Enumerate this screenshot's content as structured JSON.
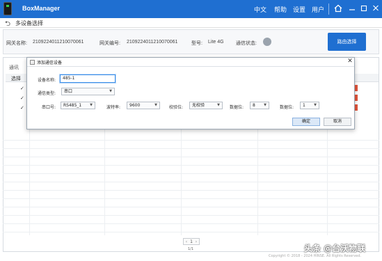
{
  "app": {
    "title": "BoxManager"
  },
  "menu": {
    "chinese": "中文",
    "help": "帮助",
    "settings": "设置",
    "user": "用户"
  },
  "sub": {
    "title": "多设备选择"
  },
  "gateway": {
    "name_label": "网关名称:",
    "name_value": "2109224011210070061",
    "id_label": "网关编号:",
    "id_value": "2109224011210070061",
    "model_label": "型号:",
    "model_value": "Lite 4G",
    "status_label": "通信状态:"
  },
  "buttons": {
    "enter": "路由选择",
    "ok": "确定",
    "cancel": "取消"
  },
  "panel": {
    "label": "通讯",
    "select_header": "选择"
  },
  "dialog": {
    "title": "添加通信设备",
    "device_name_label": "设备名称:",
    "device_name_value": "485-1",
    "comm_type_label": "通信类型:",
    "comm_type_value": "串口",
    "port_label": "串口号:",
    "port_value": "RS485_1",
    "baud_label": "波特率:",
    "baud_value": "9600",
    "parity_label": "校验位:",
    "parity_value": "无校验",
    "databits_label": "数据位:",
    "databits_value": "8",
    "stopbits_label": "数据位:",
    "stopbits_value": "1"
  },
  "pager": {
    "page": "1",
    "count": "1/1"
  },
  "footer": {
    "copyright": "Copyright © 2018 - 2024 HINSE. All Rights Reserved."
  },
  "watermark": {
    "text": "头条 @台沃物联"
  },
  "colors": {
    "brand": "#1f6fd1",
    "status_off": "#9aa3ad",
    "alert": "#e2553b"
  }
}
